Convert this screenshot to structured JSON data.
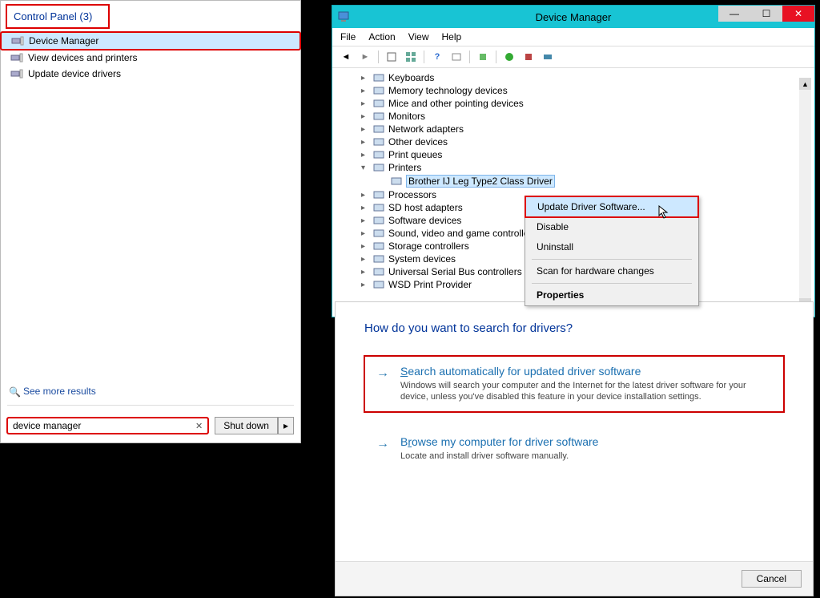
{
  "startMenu": {
    "header": "Control Panel (3)",
    "items": [
      {
        "label": "Device Manager",
        "selected": true
      },
      {
        "label": "View devices and printers",
        "selected": false
      },
      {
        "label": "Update device drivers",
        "selected": false
      }
    ],
    "seeMore": "See more results",
    "searchValue": "device manager",
    "shutdown": "Shut down"
  },
  "dmWindow": {
    "title": "Device Manager",
    "menus": [
      "File",
      "Action",
      "View",
      "Help"
    ],
    "tree": [
      {
        "label": "Keyboards",
        "indent": 1,
        "expanded": false
      },
      {
        "label": "Memory technology devices",
        "indent": 1,
        "expanded": false
      },
      {
        "label": "Mice and other pointing devices",
        "indent": 1,
        "expanded": false
      },
      {
        "label": "Monitors",
        "indent": 1,
        "expanded": false
      },
      {
        "label": "Network adapters",
        "indent": 1,
        "expanded": false
      },
      {
        "label": "Other devices",
        "indent": 1,
        "expanded": false
      },
      {
        "label": "Print queues",
        "indent": 1,
        "expanded": false
      },
      {
        "label": "Printers",
        "indent": 1,
        "expanded": true
      },
      {
        "label": "Brother IJ Leg Type2 Class Driver",
        "indent": 2,
        "expanded": null,
        "selected": true
      },
      {
        "label": "Processors",
        "indent": 1,
        "expanded": false
      },
      {
        "label": "SD host adapters",
        "indent": 1,
        "expanded": false
      },
      {
        "label": "Software devices",
        "indent": 1,
        "expanded": false
      },
      {
        "label": "Sound, video and game controllers",
        "indent": 1,
        "expanded": false
      },
      {
        "label": "Storage controllers",
        "indent": 1,
        "expanded": false
      },
      {
        "label": "System devices",
        "indent": 1,
        "expanded": false
      },
      {
        "label": "Universal Serial Bus controllers",
        "indent": 1,
        "expanded": false
      },
      {
        "label": "WSD Print Provider",
        "indent": 1,
        "expanded": false
      }
    ]
  },
  "contextMenu": {
    "items": [
      {
        "label": "Update Driver Software...",
        "highlighted": true
      },
      {
        "label": "Disable"
      },
      {
        "label": "Uninstall"
      },
      {
        "hr": true
      },
      {
        "label": "Scan for hardware changes"
      },
      {
        "hr": true
      },
      {
        "label": "Properties",
        "bold": true
      }
    ]
  },
  "wizard": {
    "title": "How do you want to search for drivers?",
    "options": [
      {
        "title": "Search automatically for updated driver software",
        "underlinePos": 0,
        "desc": "Windows will search your computer and the Internet for the latest driver software for your device, unless you've disabled this feature in your device installation settings.",
        "highlighted": true
      },
      {
        "title": "Browse my computer for driver software",
        "underlinePos": 1,
        "desc": "Locate and install driver software manually.",
        "highlighted": false
      }
    ],
    "cancel": "Cancel"
  }
}
